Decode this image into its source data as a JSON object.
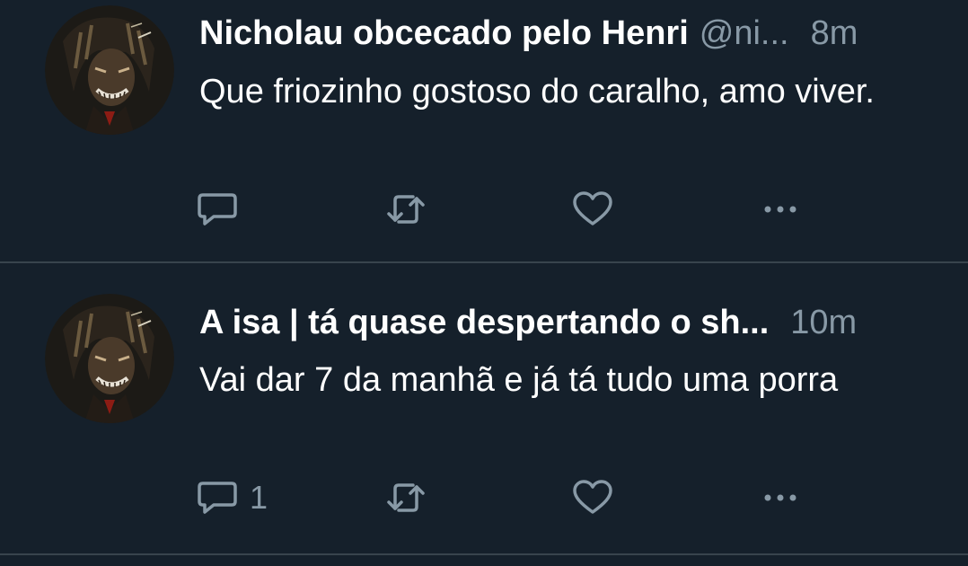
{
  "colors": {
    "background": "#15202b",
    "divider": "#38444d",
    "text_primary": "#ffffff",
    "text_secondary": "#8899a6"
  },
  "tweets": [
    {
      "display_name": "Nicholau obcecado pelo Henri",
      "handle": "@ni...",
      "timestamp": "8m",
      "text": "Que friozinho gostoso do caralho, amo viver.",
      "avatar_icon": "profile-avatar",
      "actions": {
        "reply_icon": "reply-icon",
        "reply_count": "",
        "retweet_icon": "retweet-icon",
        "like_icon": "heart-icon",
        "more_icon": "more-dots-icon"
      }
    },
    {
      "display_name": "A isa | tá quase despertando o sh...",
      "handle": "",
      "timestamp": "10m",
      "text": "Vai dar 7 da manhã e já tá tudo uma porra",
      "avatar_icon": "profile-avatar",
      "actions": {
        "reply_icon": "reply-icon",
        "reply_count": "1",
        "retweet_icon": "retweet-icon",
        "like_icon": "heart-icon",
        "more_icon": "more-dots-icon"
      }
    }
  ]
}
